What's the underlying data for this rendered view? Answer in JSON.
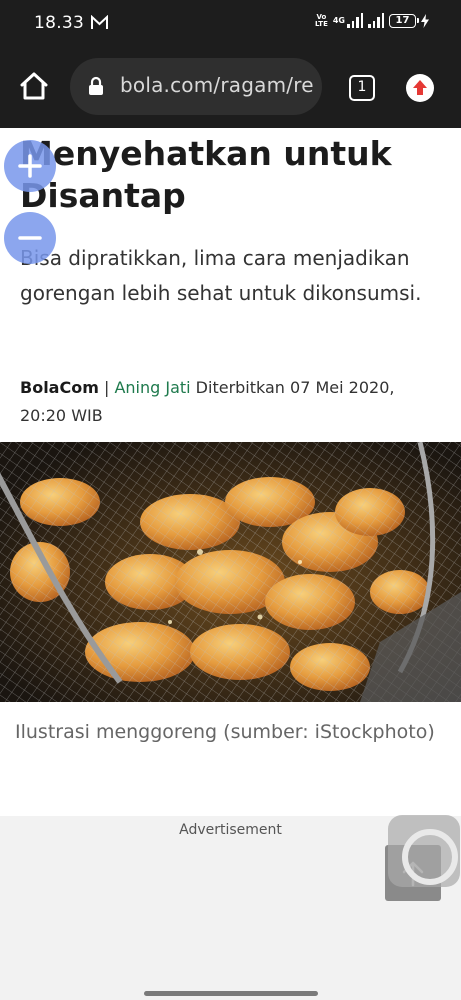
{
  "status_bar": {
    "time": "18.33",
    "volte_label": "Vo\nLTE",
    "network_type": "4G",
    "battery_level": "17",
    "icons": [
      "gmail-icon",
      "volte-icon",
      "signal-icon",
      "signal-icon",
      "battery-icon",
      "charging-icon"
    ]
  },
  "browser": {
    "url": "bola.com/ragam/read",
    "tab_count": "1",
    "icons": [
      "home-icon",
      "lock-icon",
      "tabs-icon",
      "update-arrow-icon"
    ]
  },
  "article": {
    "headline": "Menyehatkan untuk Disantap",
    "subtitle": "Bisa dipratikkan, lima cara menjadikan gorengan lebih sehat untuk dikonsumsi.",
    "publisher": "BolaCom",
    "separator": " | ",
    "author": "Aning Jati",
    "published_label": " Diterbitkan 07 Mei 2020, 20:20 WIB",
    "image_caption": "Ilustrasi menggoreng (sumber: iStockphoto)"
  },
  "zoom": {
    "in_label": "+",
    "out_label": "−"
  },
  "ad": {
    "label": "Advertisement"
  },
  "colors": {
    "bar_background": "#1d1d1d",
    "author_link": "#1f7a4d",
    "zoom_button": "#7896eb",
    "update_arrow": "#e53935"
  }
}
